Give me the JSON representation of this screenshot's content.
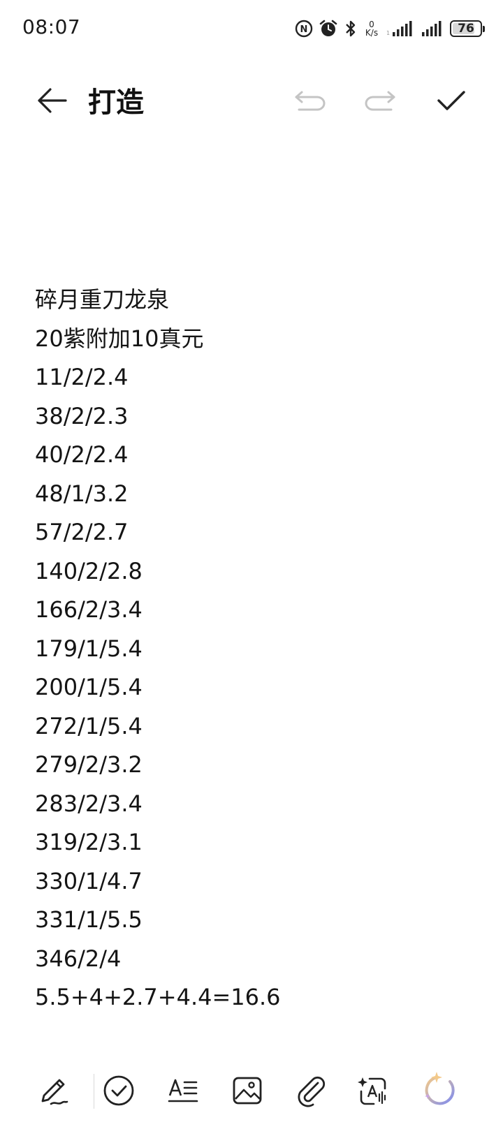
{
  "status_bar": {
    "time": "08:07",
    "net_speed_value": "0",
    "net_speed_unit": "K/s",
    "battery_level": "76",
    "icons": [
      "nfc-icon",
      "alarm-icon",
      "bluetooth-icon",
      "signal-icon",
      "signal-icon",
      "battery-icon"
    ]
  },
  "toolbar": {
    "title": "打造",
    "icons": [
      "back-arrow-icon",
      "undo-icon",
      "redo-icon",
      "check-icon"
    ]
  },
  "note": {
    "lines": [
      "碎月重刀龙泉",
      "20紫附加10真元",
      "11/2/2.4",
      "38/2/2.3",
      "40/2/2.4",
      "48/1/3.2",
      "57/2/2.7",
      "140/2/2.8",
      "166/2/3.4",
      "179/1/5.4",
      "200/1/5.4",
      "272/1/5.4",
      "279/2/3.2",
      "283/2/3.4",
      "319/2/3.1",
      "330/1/4.7",
      "331/1/5.5",
      "346/2/4",
      "5.5+4+2.7+4.4=16.6"
    ]
  },
  "bottom_bar": {
    "icons": [
      "handwriting-pen-icon",
      "checklist-icon",
      "text-format-icon",
      "image-icon",
      "attachment-icon",
      "ai-text-scan-icon",
      "ai-assistant-icon"
    ]
  },
  "colors": {
    "text": "#141414",
    "background": "#ffffff",
    "ai_gradient_start": "#f3c98a",
    "ai_gradient_end": "#7f8cf0"
  }
}
